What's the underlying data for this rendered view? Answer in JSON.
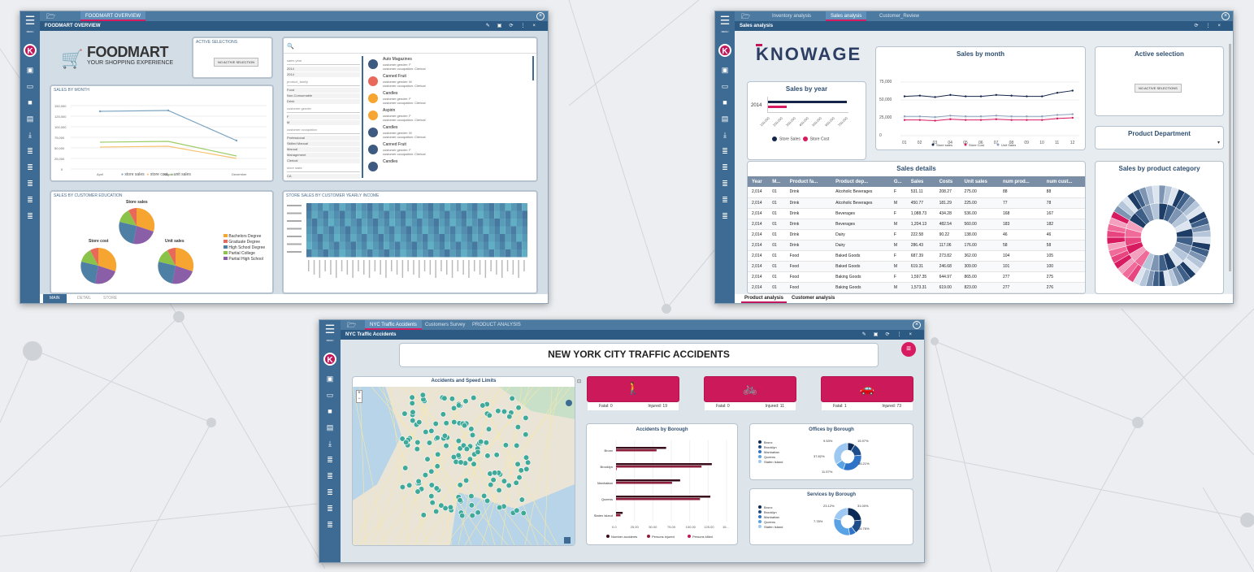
{
  "win1": {
    "tab": "FOODMART OVERVIEW",
    "toolbar_title": "FOODMART OVERVIEW",
    "logo_title": "FOODMART",
    "logo_sub": "YOUR SHOPPING EXPERIENCE",
    "active_selections": "ACTIVE SELECTIONS",
    "no_active": "NO ACTIVE SELECTION",
    "sales_by_month": "SALES BY MONTH",
    "y_ticks": [
      "100,000",
      "125,000",
      "100,000",
      "75,000",
      "50,000",
      "25,000",
      "0"
    ],
    "x_ticks": [
      "April",
      "August",
      "December"
    ],
    "legend": [
      "store sales",
      "store cost",
      "unit sales"
    ],
    "selector_groups": [
      {
        "label": "sales year",
        "items": [
          "2014",
          "2014"
        ]
      },
      {
        "label": "product_family",
        "items": [
          "Food",
          "Non-Consumable",
          "Drink"
        ]
      },
      {
        "label": "customer gender",
        "items": [
          "F",
          "M"
        ]
      },
      {
        "label": "customer occupation",
        "items": [
          "Professional",
          "Skilled Manual",
          "Manual",
          "Management",
          "Clerical"
        ]
      },
      {
        "label": "store state",
        "items": [
          "CA"
        ]
      }
    ],
    "products": [
      {
        "name": "Auto Magazines",
        "l1": "customer gender: F",
        "l2": "customer occupation: Clerical"
      },
      {
        "name": "Canned Fruit",
        "l1": "customer gender: M",
        "l2": "customer occupation: Clerical"
      },
      {
        "name": "Candles",
        "l1": "customer gender: F",
        "l2": "customer occupation: Clerical"
      },
      {
        "name": "Aspirin",
        "l1": "customer gender: F",
        "l2": "customer occupation: Clerical"
      },
      {
        "name": "Candles",
        "l1": "customer gender: M",
        "l2": "customer occupation: Clerical"
      },
      {
        "name": "Canned Fruit",
        "l1": "customer gender: F",
        "l2": "customer occupation: Clerical"
      },
      {
        "name": "Candles",
        "l1": "",
        "l2": ""
      }
    ],
    "sales_by_edu": "SALES BY CUSTOMER EDUCATION",
    "pie_titles": [
      "Store sales",
      "Store cost",
      "Unit sales"
    ],
    "edu_legend": [
      "Bachelors Degree",
      "Graduate Degree",
      "High School Degree",
      "Partial College",
      "Partial High School"
    ],
    "heatmap_title": "STORE SALES BY CUSTOMER YEARLY INCOME",
    "bottom_tabs": [
      "MAIN",
      "DETAIL",
      "STORE"
    ],
    "colors": {
      "blue": "#4e7fa5",
      "orange": "#f6a531",
      "purple": "#8b5fa8",
      "green": "#8bc34a",
      "red": "#e8695a"
    }
  },
  "win2": {
    "tabs": [
      "Inventory analysis",
      "Sales analysis",
      "Customer_Review"
    ],
    "toolbar_title": "Sales analysis",
    "logo": "KNOWAGE",
    "sales_by_year": "Sales by year",
    "year": "2014",
    "year_ticks": [
      "100,000",
      "200,000",
      "300,000",
      "400,000",
      "500,000",
      "600,000",
      "700,000"
    ],
    "year_legend": [
      "Store Sales",
      "Store Cost"
    ],
    "sales_by_month": "Sales by month",
    "month_y": [
      "75,000",
      "50,000",
      "25,000",
      "0"
    ],
    "month_x": [
      "01",
      "02",
      "03",
      "04",
      "05",
      "06",
      "07",
      "08",
      "09",
      "10",
      "11",
      "12"
    ],
    "month_legend": [
      "Store sales",
      "Store Cost",
      "Unit Sales"
    ],
    "active_selection": "Active selection",
    "no_active": "NO ACTIVE SELECTIONS",
    "product_department": "Product Department",
    "sales_details": "Sales details",
    "columns": [
      "Year",
      "M...",
      "Product fa...",
      "Product dep...",
      "G...",
      "Sales",
      "Costs",
      "Unit sales",
      "num prod...",
      "num cust..."
    ],
    "rows": [
      [
        "2,014",
        "01",
        "Drink",
        "Alcoholic Beverages",
        "F",
        "531.11",
        "208.27",
        "275.00",
        "88",
        "88"
      ],
      [
        "2,014",
        "01",
        "Drink",
        "Alcoholic Beverages",
        "M",
        "450.77",
        "181.29",
        "225.00",
        "77",
        "78"
      ],
      [
        "2,014",
        "01",
        "Drink",
        "Beverages",
        "F",
        "1,088.73",
        "434.28",
        "536.00",
        "168",
        "167"
      ],
      [
        "2,014",
        "01",
        "Drink",
        "Beverages",
        "M",
        "1,204.13",
        "482.54",
        "560.00",
        "183",
        "182"
      ],
      [
        "2,014",
        "01",
        "Drink",
        "Dairy",
        "F",
        "222.58",
        "90.22",
        "138.00",
        "46",
        "46"
      ],
      [
        "2,014",
        "01",
        "Drink",
        "Dairy",
        "M",
        "286.43",
        "117.06",
        "176.00",
        "58",
        "58"
      ],
      [
        "2,014",
        "01",
        "Food",
        "Baked Goods",
        "F",
        "687.39",
        "273.82",
        "362.00",
        "104",
        "105"
      ],
      [
        "2,014",
        "01",
        "Food",
        "Baked Goods",
        "M",
        "619.31",
        "246.68",
        "309.00",
        "101",
        "100"
      ],
      [
        "2,014",
        "01",
        "Food",
        "Baking Goods",
        "F",
        "1,597.35",
        "644.97",
        "865.00",
        "277",
        "275"
      ],
      [
        "2,014",
        "01",
        "Food",
        "Baking Goods",
        "M",
        "1,573.31",
        "619.00",
        "823.00",
        "277",
        "276"
      ]
    ],
    "sales_by_category": "Sales by product category",
    "bottom_tabs": [
      "Product analysis",
      "Customer analysis"
    ]
  },
  "win3": {
    "tabs": [
      "NYC Traffic Accidents",
      "Customers Survey",
      "PRODUCT ANALYSIS"
    ],
    "toolbar_title": "NYC Traffic Accidents",
    "title": "NEW YORK CITY TRAFFIC ACCIDENTS",
    "map_title": "Accidents and Speed Limits",
    "kpis": [
      {
        "icon": "pedestrian-icon",
        "fatal": "Fatal: 0",
        "injured": "Injured: 19"
      },
      {
        "icon": "bicycle-icon",
        "fatal": "Fatal: 0",
        "injured": "Injured: 11"
      },
      {
        "icon": "car-icon",
        "fatal": "Fatal: 1",
        "injured": "Injured: 73"
      }
    ],
    "borough_title": "Accidents by Borough",
    "boroughs": [
      "Bronx",
      "Brooklyn",
      "Manhattan",
      "Queens",
      "Staten Island"
    ],
    "borough_x": [
      "0.0",
      "25.00",
      "50.00",
      "75.00",
      "100.00",
      "125.00",
      "15..."
    ],
    "borough_legend": [
      "Number accidents",
      "Persons injured",
      "Persons killed"
    ],
    "offices_title": "Offices by Borough",
    "offices_labels": [
      "9.53%",
      "15.97%",
      "37.82%",
      "35.21%",
      "11.57%"
    ],
    "services_title": "Services by Borough",
    "services_labels": [
      "23.12%",
      "31.00%",
      "7.78%",
      "16.76%"
    ],
    "chart_data": {
      "type": "bar",
      "categories": [
        "Bronx",
        "Brooklyn",
        "Manhattan",
        "Queens",
        "Staten Island"
      ],
      "series": [
        {
          "name": "Number accidents",
          "values": [
            68,
            130,
            87,
            128,
            9
          ]
        },
        {
          "name": "Persons injured",
          "values": [
            55,
            116,
            76,
            114,
            6
          ]
        },
        {
          "name": "Persons killed",
          "values": [
            0,
            1,
            0,
            0,
            0
          ]
        }
      ],
      "xlim": [
        0,
        150
      ]
    }
  }
}
